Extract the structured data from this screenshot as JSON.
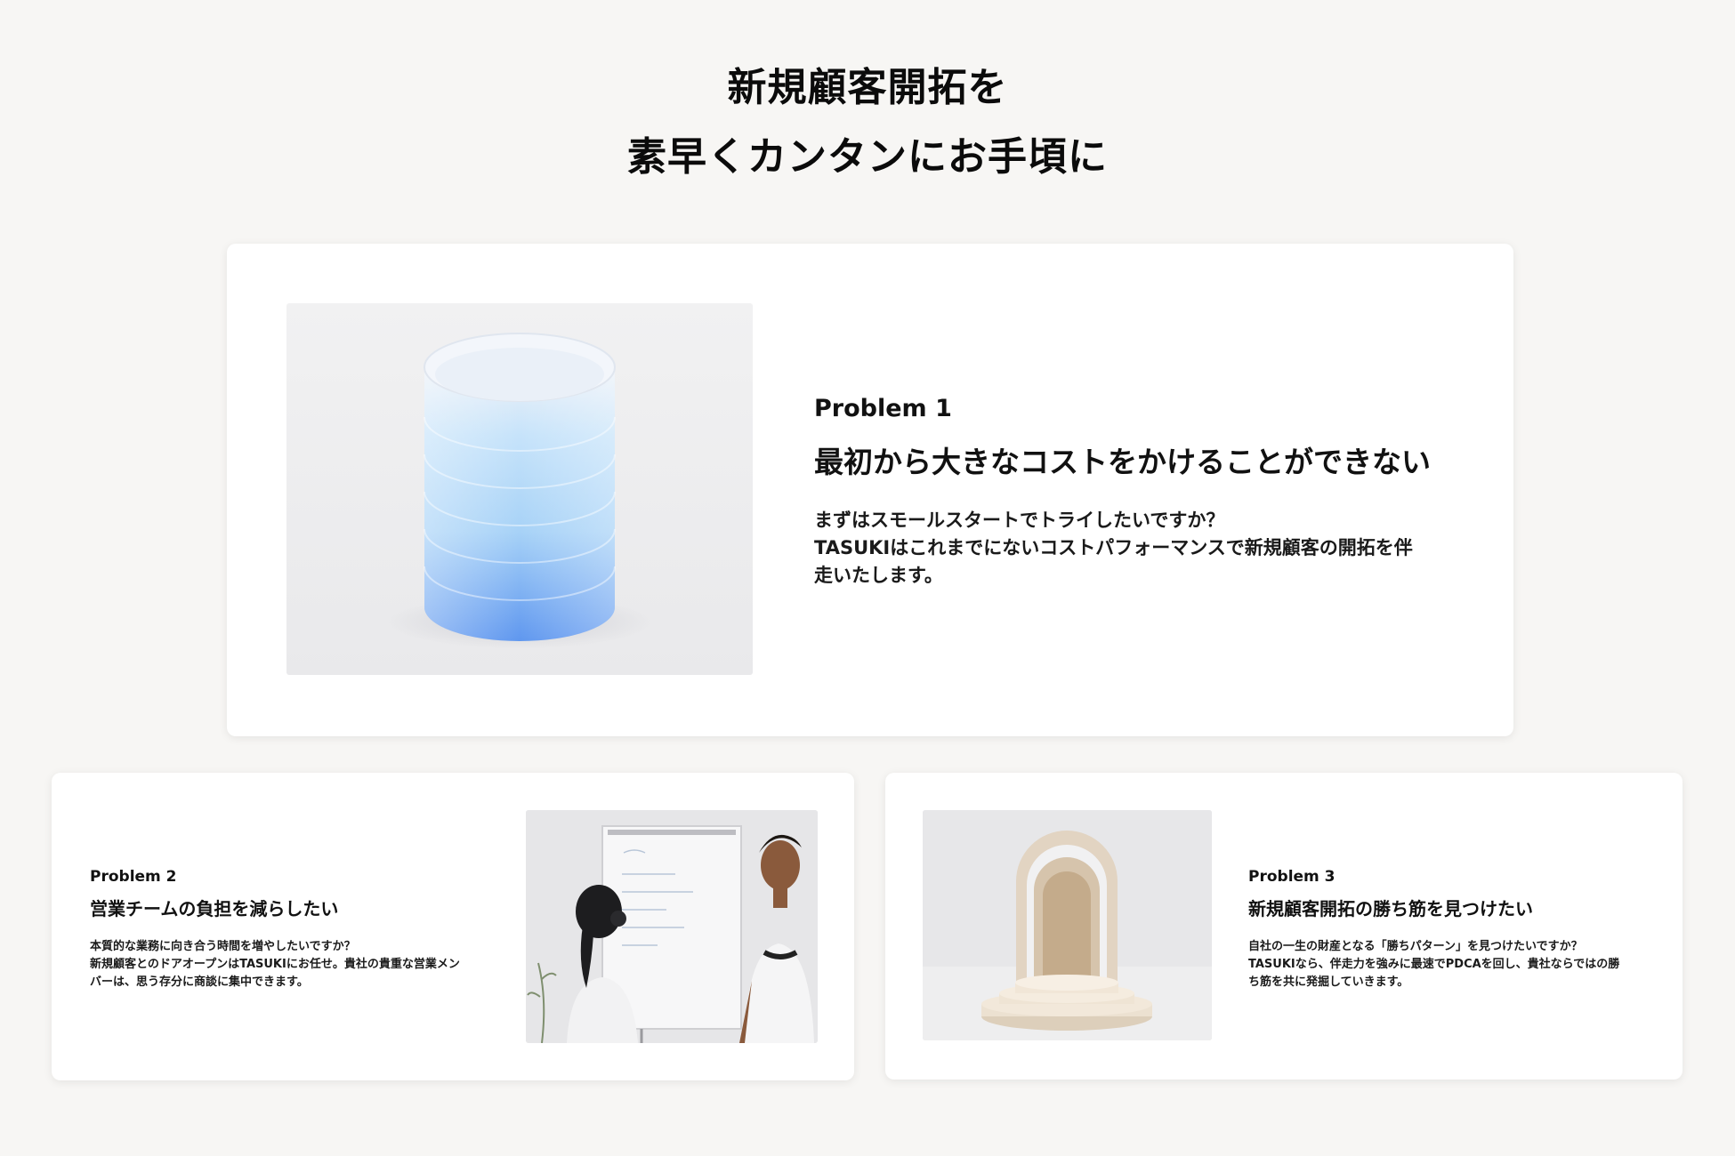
{
  "hero": {
    "line1": "新規顧客開拓を",
    "line2": "素早くカンタンにお手頃に"
  },
  "problems": [
    {
      "label": "Problem 1",
      "heading": "最初から大きなコストをかけることができない",
      "body_lines": [
        "まずはスモールスタートでトライしたいですか？",
        "TASUKIはこれまでにないコストパフォーマンスで新規顧客の開拓を伴",
        "走いたします。"
      ],
      "image": "stacked-cylinder-illustration"
    },
    {
      "label": "Problem 2",
      "heading": "営業チームの負担を減らしたい",
      "body_lines": [
        "本質的な業務に向き合う時間を増やしたいですか？",
        "新規顧客とのドアオープンはTASUKIにお任せ。貴社の貴重な営業メン",
        "バーは、思う存分に商談に集中できます。"
      ],
      "image": "two-people-whiteboard-photo"
    },
    {
      "label": "Problem 3",
      "heading": "新規顧客開拓の勝ち筋を見つけたい",
      "body_lines": [
        "自社の一生の財産となる「勝ちパターン」を見つけたいですか？",
        "TASUKIなら、伴走力を強みに最速でPDCAを回し、貴社ならではの勝",
        "ち筋を共に発掘していきます。"
      ],
      "image": "arch-doorway-illustration"
    }
  ],
  "colors": {
    "background": "#f7f6f4",
    "card": "#ffffff",
    "text": "#111111",
    "cylinder_top": "#e8eef7",
    "cylinder_bottom": "#5b93ef"
  }
}
